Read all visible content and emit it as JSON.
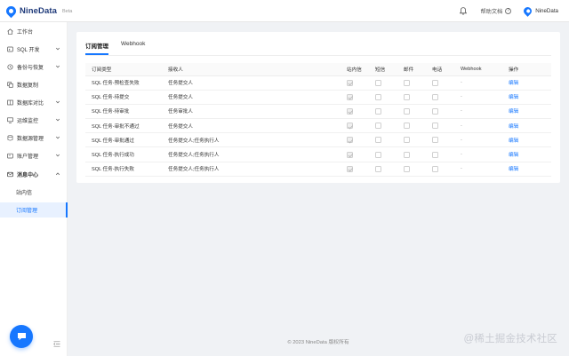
{
  "header": {
    "brand": "NineData",
    "beta": "Beta",
    "help_label": "帮助文档",
    "help_icon": "?",
    "user_label": "NineData"
  },
  "sidebar": {
    "items": [
      {
        "label": "工作台",
        "icon": "home-icon"
      },
      {
        "label": "SQL 开发",
        "icon": "code-icon"
      },
      {
        "label": "备份与恢复",
        "icon": "backup-icon"
      },
      {
        "label": "数据复制",
        "icon": "copy-icon"
      },
      {
        "label": "数据库对比",
        "icon": "compare-icon"
      },
      {
        "label": "运维监控",
        "icon": "monitor-icon"
      },
      {
        "label": "数据源管理",
        "icon": "datasource-icon"
      },
      {
        "label": "账户管理",
        "icon": "account-icon"
      },
      {
        "label": "消息中心",
        "icon": "message-icon"
      },
      {
        "label": "站内信"
      },
      {
        "label": "订阅管理"
      }
    ]
  },
  "tabs": [
    "订阅管理",
    "Webhook"
  ],
  "table": {
    "headers": [
      "订阅类型",
      "接收人",
      "站内信",
      "短信",
      "邮件",
      "电话",
      "Webhook",
      "操作"
    ],
    "rows": [
      {
        "type": "SQL 任务-预检查失败",
        "receiver": "任务提交人",
        "site": true,
        "sms": false,
        "email": false,
        "phone": false,
        "webhook": "-",
        "action": "编辑"
      },
      {
        "type": "SQL 任务-待提交",
        "receiver": "任务提交人",
        "site": true,
        "sms": false,
        "email": false,
        "phone": false,
        "webhook": "-",
        "action": "编辑"
      },
      {
        "type": "SQL 任务-待审批",
        "receiver": "任务审批人",
        "site": true,
        "sms": false,
        "email": false,
        "phone": false,
        "webhook": "-",
        "action": "编辑"
      },
      {
        "type": "SQL 任务-审批不通过",
        "receiver": "任务提交人",
        "site": true,
        "sms": false,
        "email": false,
        "phone": false,
        "webhook": "-",
        "action": "编辑"
      },
      {
        "type": "SQL 任务-审批通过",
        "receiver": "任务提交人;任务执行人",
        "site": true,
        "sms": false,
        "email": false,
        "phone": false,
        "webhook": "-",
        "action": "编辑"
      },
      {
        "type": "SQL 任务-执行成功",
        "receiver": "任务提交人;任务执行人",
        "site": true,
        "sms": false,
        "email": false,
        "phone": false,
        "webhook": "-",
        "action": "编辑"
      },
      {
        "type": "SQL 任务-执行失败",
        "receiver": "任务提交人;任务执行人",
        "site": true,
        "sms": false,
        "email": false,
        "phone": false,
        "webhook": "-",
        "action": "编辑"
      }
    ]
  },
  "footer": "© 2023 NineData 版权所有",
  "watermark": "@稀土掘金技术社区",
  "colors": {
    "accent": "#1677ff",
    "active_bg": "#e8f1ff"
  }
}
